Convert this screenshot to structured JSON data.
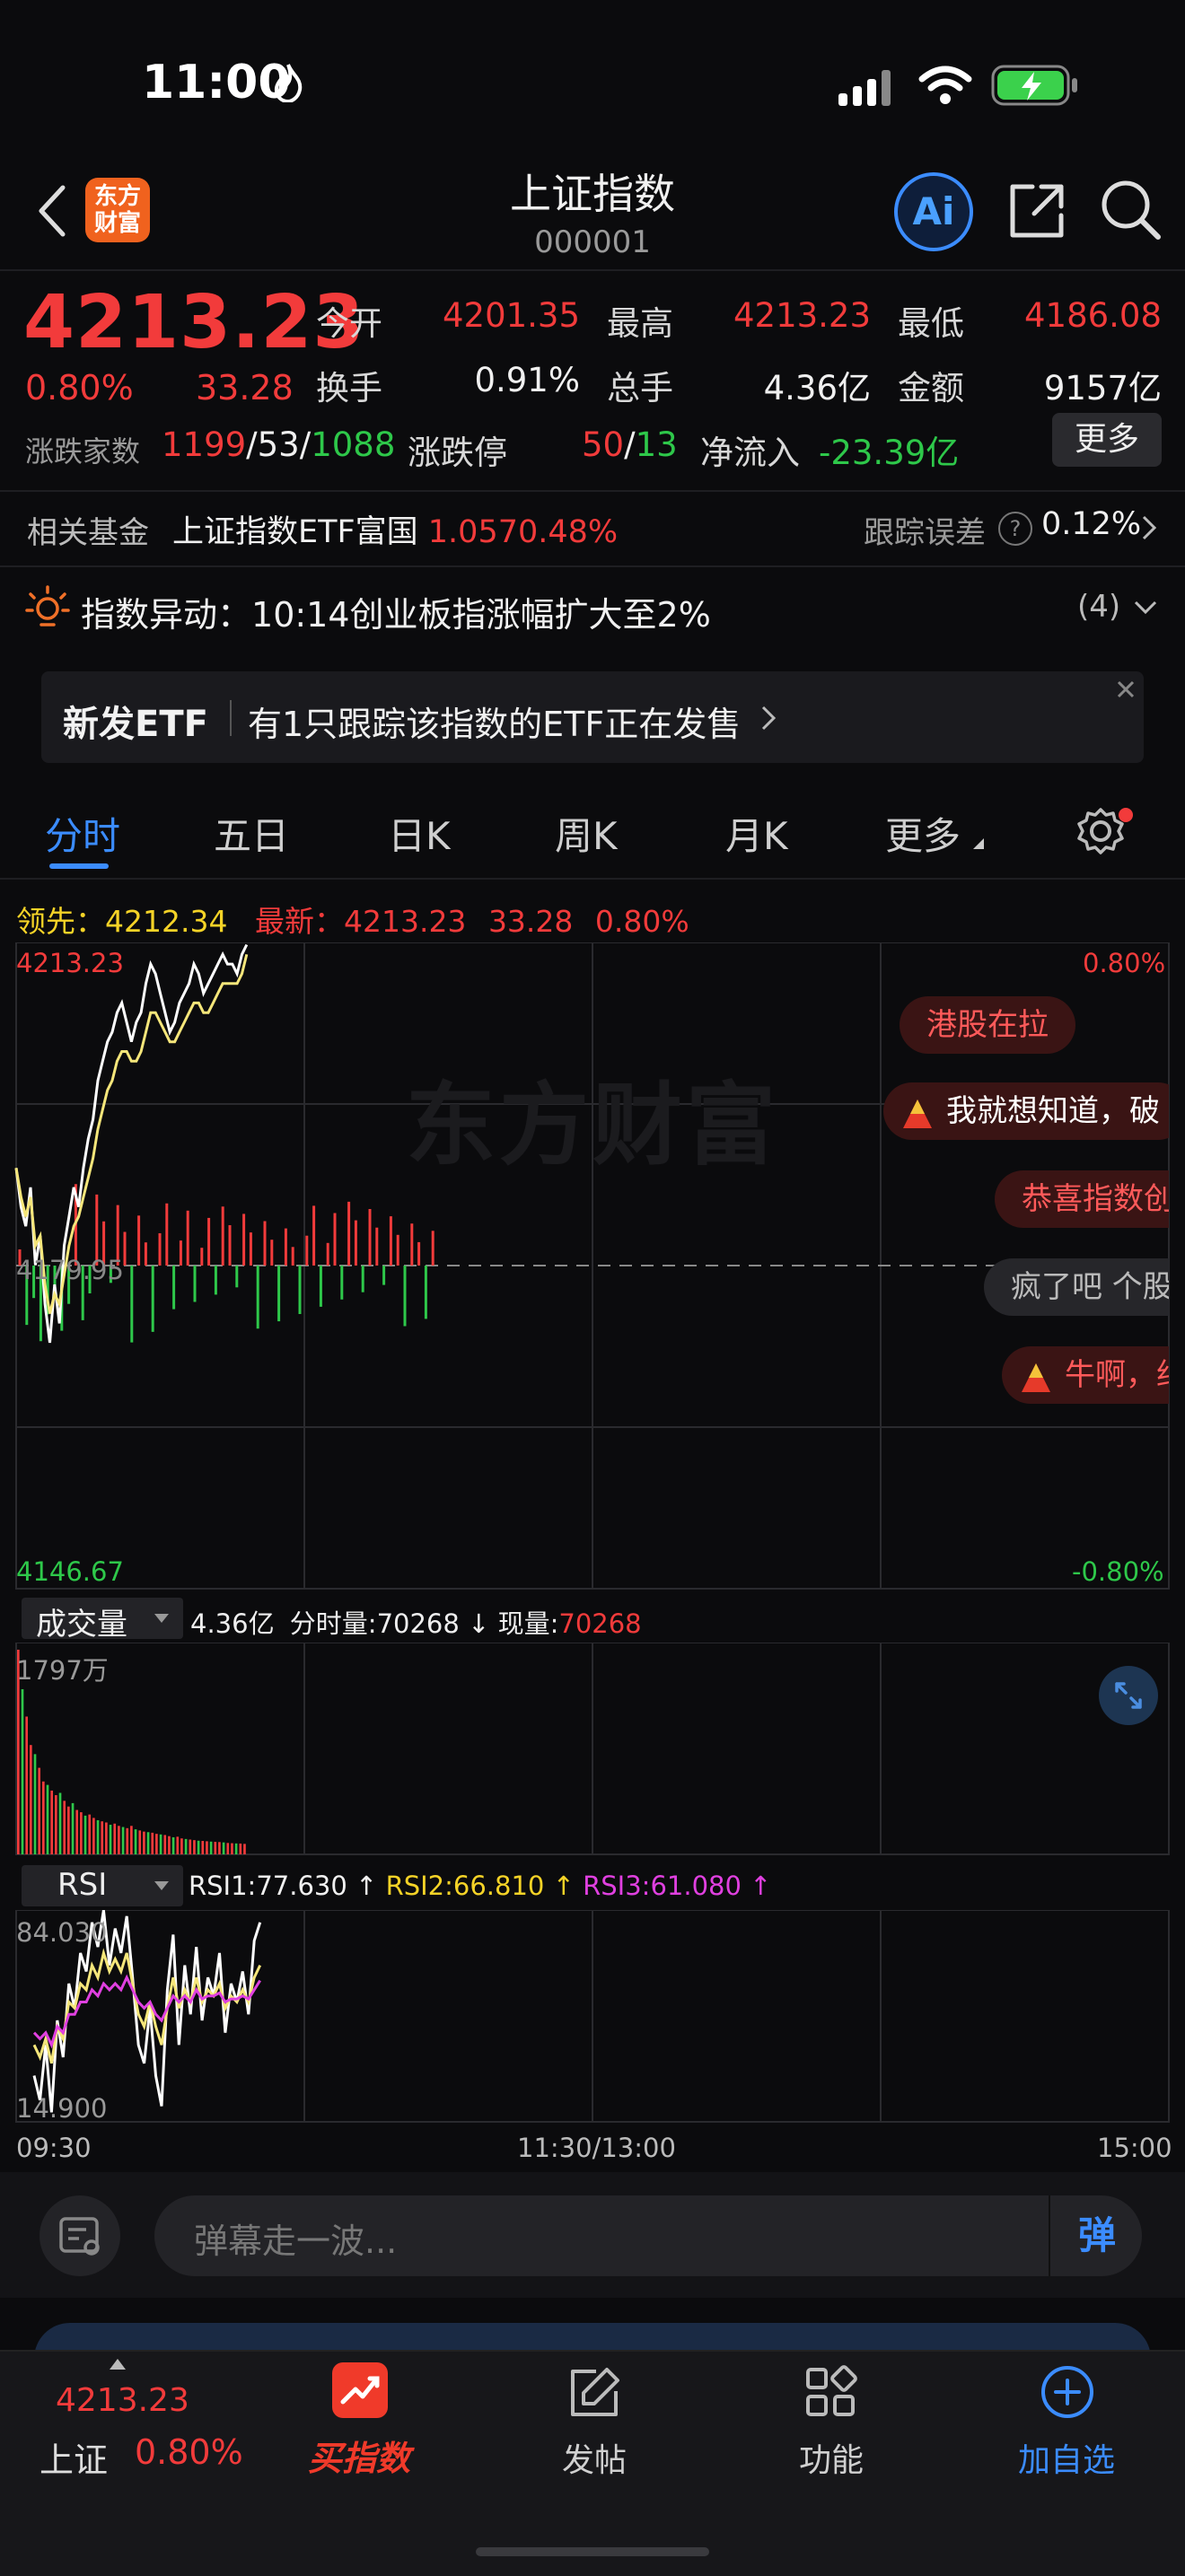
{
  "status_bar": {
    "time": "11:00"
  },
  "header": {
    "title": "上证指数",
    "code": "000001",
    "logo_text": "东方财富",
    "ai_label": "Ai"
  },
  "quote": {
    "price": "4213.23",
    "change_pct": "0.80%",
    "change": "33.28",
    "open_label": "今开",
    "open": "4201.35",
    "high_label": "最高",
    "high": "4213.23",
    "low_label": "最低",
    "low": "4186.08",
    "turnover_label": "换手",
    "turnover": "0.91%",
    "volume_label": "总手",
    "volume": "4.36亿",
    "amount_label": "金额",
    "amount": "9157亿",
    "breadth_label": "涨跌家数",
    "breadth_up": "1199",
    "breadth_flat": "53",
    "breadth_down": "1088",
    "limit_label": "涨跌停",
    "limit_up": "50",
    "limit_down": "13",
    "netflow_label": "净流入",
    "netflow": "-23.39亿",
    "more_label": "更多"
  },
  "fund_row": {
    "label": "相关基金",
    "name": "上证指数ETF富国",
    "price": "1.057",
    "pct": "0.48%",
    "track_label": "跟踪误差",
    "track_value": "0.12%"
  },
  "alert": {
    "title": "指数异动：",
    "text": "10:14创业板指涨幅扩大至2%",
    "count": "(4)"
  },
  "etf_banner": {
    "label": "新发ETF",
    "text": "有1只跟踪该指数的ETF正在发售"
  },
  "chart_tabs": [
    "分时",
    "五日",
    "日K",
    "周K",
    "月K",
    "更多"
  ],
  "legend": {
    "lead_label": "领先：",
    "lead_value": "4212.34",
    "latest_label": "最新：",
    "latest_value": "4213.23",
    "latest_change": "33.28",
    "latest_pct": "0.80%"
  },
  "price_axis": {
    "top": "4213.23",
    "mid": "4179.95",
    "bottom": "4146.67",
    "top_pct": "0.80%",
    "bottom_pct": "-0.80%",
    "watermark": "东方财富"
  },
  "danmaku": [
    "港股在拉",
    "我就想知道，破",
    "恭喜指数创",
    "疯了吧 个股",
    "牛啊，约"
  ],
  "volume_panel": {
    "selector": "成交量",
    "total": "4.36亿",
    "minute_label": "分时量:",
    "minute_value": "70268",
    "now_label": "现量:",
    "now_value": "70268",
    "axis_top": "1797万"
  },
  "rsi_panel": {
    "selector": "RSI",
    "rsi1": "RSI1:77.630",
    "rsi2": "RSI2:66.810",
    "rsi3": "RSI3:61.080",
    "axis_top": "84.030",
    "axis_bottom": "14.900"
  },
  "time_axis": {
    "start": "09:30",
    "mid": "11:30/13:00",
    "end": "15:00"
  },
  "comment_input": {
    "placeholder": "弹幕走一波...",
    "toggle_label": "弹"
  },
  "bottom_nav": {
    "index_price": "4213.23",
    "index_name": "上证",
    "index_pct": "0.80%",
    "items": [
      {
        "label": "买指数"
      },
      {
        "label": "发帖"
      },
      {
        "label": "功能"
      },
      {
        "label": "加自选"
      }
    ]
  },
  "colors": {
    "up": "#f23b3b",
    "down": "#2ec84a",
    "accent": "#3b8cff",
    "avg_line": "#f5e67a",
    "rsi3": "#e040e0"
  },
  "chart_data": [
    {
      "type": "line",
      "title": "",
      "ylim": [
        4146.67,
        4213.23
      ],
      "x_range": [
        "09:30",
        "15:00"
      ],
      "series": [
        {
          "values": [
            4190,
            4186,
            4184,
            4188,
            4180,
            4183,
            4176,
            4172,
            4178,
            4174,
            4182,
            4185,
            4188,
            4186,
            4190,
            4193,
            4195,
            4199,
            4201,
            4203,
            4204,
            4206,
            4207,
            4205,
            4203,
            4205,
            4206,
            4209,
            4211,
            4210,
            4208,
            4206,
            4204,
            4205,
            4207,
            4208,
            4209,
            4211,
            4210,
            4208,
            4209,
            4210,
            4211,
            4212,
            4211,
            4211,
            4210,
            4212,
            4213
          ]
        },
        {
          "values": [
            4190,
            4187,
            4185,
            4187,
            4182,
            4183,
            4178,
            4175,
            4177,
            4176,
            4179,
            4182,
            4184,
            4185,
            4187,
            4189,
            4191,
            4194,
            4196,
            4198,
            4199,
            4201,
            4202,
            4202,
            4201,
            4201,
            4202,
            4204,
            4206,
            4206,
            4205,
            4204,
            4203,
            4203,
            4204,
            4205,
            4206,
            4207,
            4207,
            4206,
            4206,
            4207,
            4208,
            4209,
            4209,
            4209,
            4209,
            4210,
            4212
          ]
        }
      ]
    },
    {
      "type": "bar",
      "title": "",
      "ylim": [
        0,
        1797
      ],
      "series": [
        {
          "values": [
            1797,
            1450,
            1210,
            960,
            880,
            760,
            640,
            610,
            560,
            520,
            540,
            470,
            420,
            450,
            390,
            370,
            340,
            350,
            320,
            300,
            290,
            280,
            260,
            270,
            250,
            240,
            230,
            250,
            220,
            210,
            200,
            195,
            190,
            180,
            175,
            170,
            160,
            150,
            155,
            140,
            135,
            130,
            125,
            120,
            118,
            115,
            112,
            110,
            108,
            105,
            100,
            98,
            96,
            95,
            92
          ]
        }
      ]
    },
    {
      "type": "line",
      "title": "",
      "ylim": [
        14.9,
        84.03
      ],
      "series": [
        {
          "name": "RSI1",
          "values": [
            30,
            22,
            40,
            18,
            48,
            36,
            60,
            52,
            70,
            64,
            80,
            72,
            84,
            66,
            78,
            70,
            82,
            62,
            40,
            34,
            52,
            30,
            20,
            58,
            76,
            40,
            66,
            50,
            72,
            48,
            62,
            56,
            70,
            44,
            60,
            54,
            64,
            50,
            74,
            80
          ]
        },
        {
          "name": "RSI2",
          "values": [
            40,
            36,
            42,
            34,
            46,
            42,
            54,
            52,
            60,
            58,
            66,
            62,
            70,
            64,
            68,
            64,
            70,
            60,
            50,
            46,
            54,
            46,
            40,
            52,
            62,
            52,
            58,
            54,
            62,
            54,
            58,
            56,
            60,
            52,
            56,
            54,
            58,
            54,
            62,
            66
          ]
        },
        {
          "name": "RSI3",
          "values": [
            44,
            42,
            44,
            40,
            46,
            44,
            50,
            50,
            54,
            54,
            58,
            56,
            60,
            58,
            60,
            58,
            62,
            58,
            54,
            52,
            54,
            50,
            48,
            52,
            56,
            54,
            56,
            54,
            58,
            55,
            56,
            56,
            57,
            54,
            55,
            55,
            56,
            55,
            58,
            61
          ]
        }
      ]
    }
  ]
}
